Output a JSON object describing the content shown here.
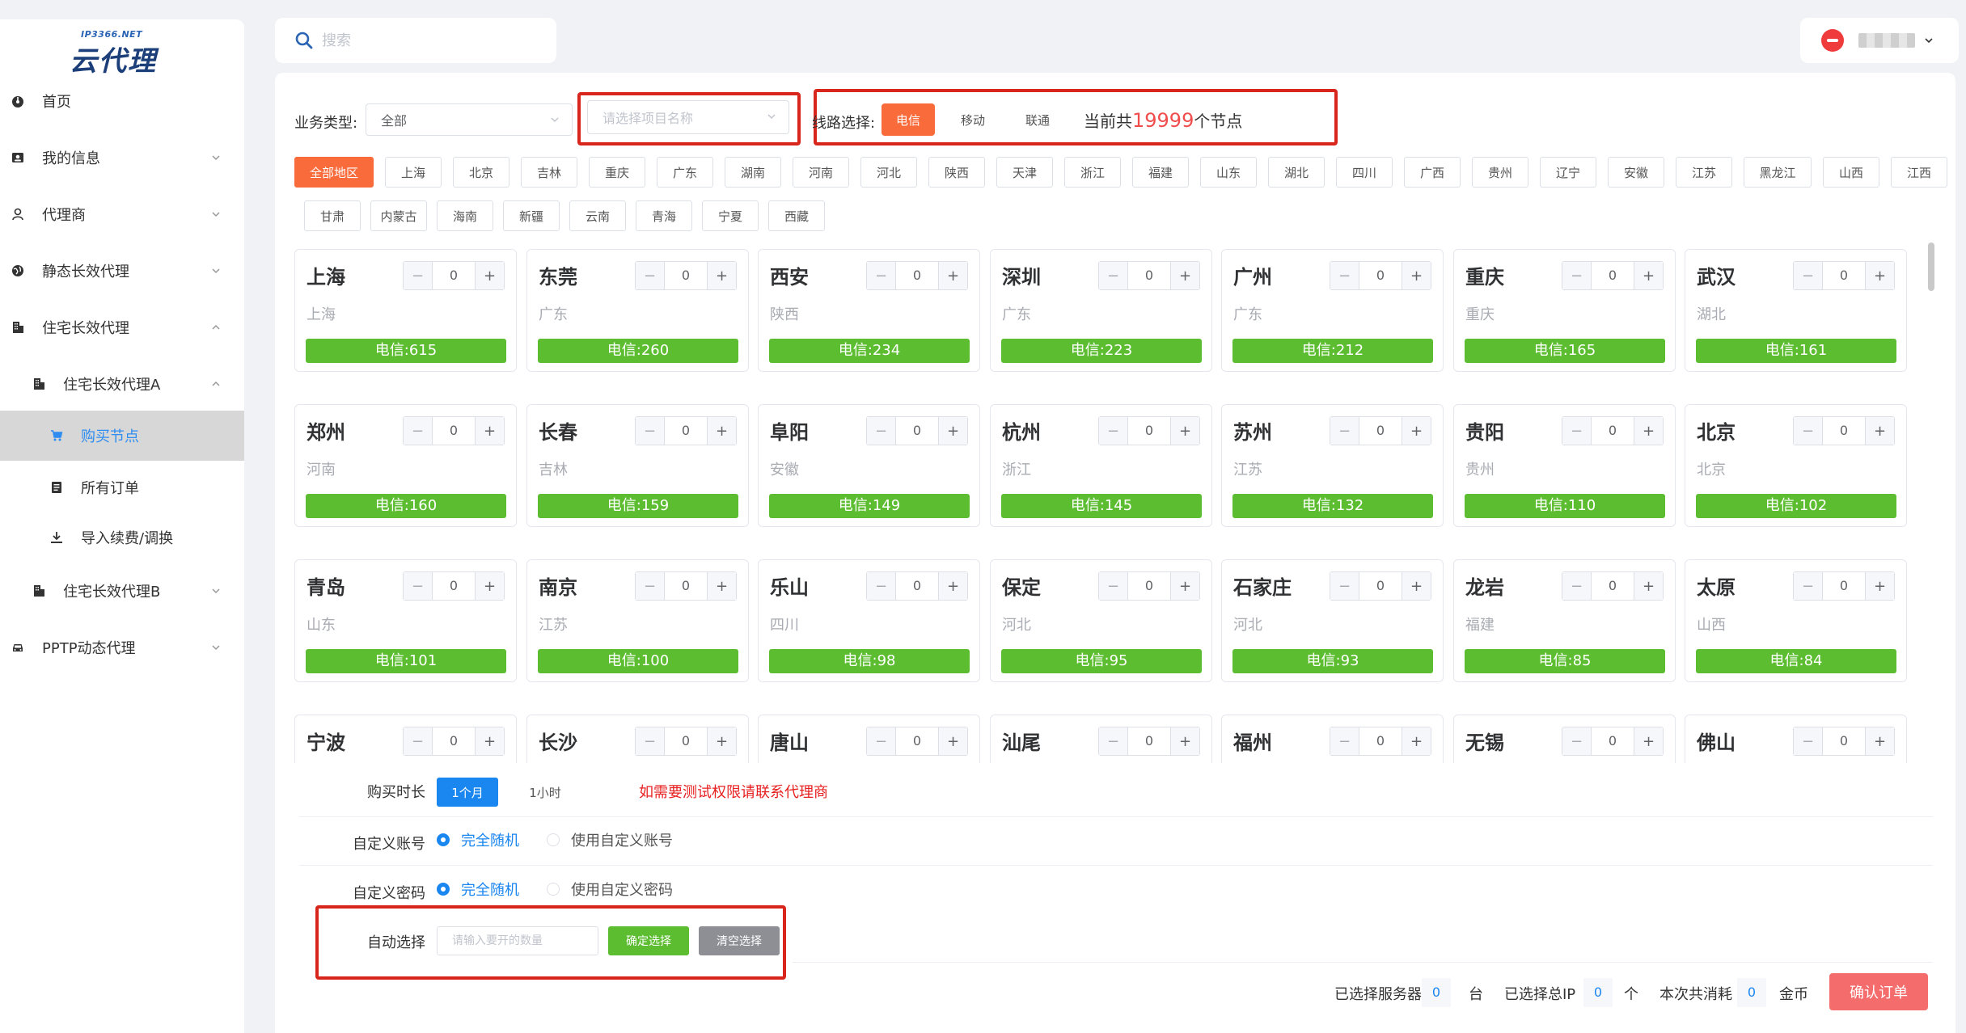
{
  "app": {
    "logo_sub": "IP3366.NET",
    "logo_main": "云代理"
  },
  "search": {
    "placeholder": "搜索"
  },
  "sidebar": {
    "items": [
      {
        "label": "首页",
        "icon": "dashboard-icon"
      },
      {
        "label": "我的信息",
        "icon": "id-card-icon"
      },
      {
        "label": "代理商",
        "icon": "user-icon"
      },
      {
        "label": "静态长效代理",
        "icon": "globe-icon"
      },
      {
        "label": "住宅长效代理",
        "icon": "building-icon"
      },
      {
        "label": "住宅长效代理A",
        "icon": "building-icon"
      },
      {
        "label": "购买节点",
        "icon": "cart-icon"
      },
      {
        "label": "所有订单",
        "icon": "list-icon"
      },
      {
        "label": "导入续费/调换",
        "icon": "import-icon"
      },
      {
        "label": "住宅长效代理B",
        "icon": "building-icon"
      },
      {
        "label": "PPTP动态代理",
        "icon": "car-icon"
      }
    ]
  },
  "filters": {
    "biz_label": "业务类型:",
    "biz_value": "全部",
    "project_placeholder": "请选择项目名称",
    "line_label": "线路选择:",
    "lines": [
      "电信",
      "移动",
      "联通"
    ],
    "count_prefix": "当前共",
    "count_value": "19999",
    "count_suffix": "个节点"
  },
  "regions": [
    "全部地区",
    "上海",
    "北京",
    "吉林",
    "重庆",
    "广东",
    "湖南",
    "河南",
    "河北",
    "陕西",
    "天津",
    "浙江",
    "福建",
    "山东",
    "湖北",
    "四川",
    "广西",
    "贵州",
    "辽宁",
    "安徽",
    "江苏",
    "黑龙江",
    "山西",
    "江西",
    "甘肃",
    "内蒙古",
    "海南",
    "新疆",
    "云南",
    "青海",
    "宁夏",
    "西藏"
  ],
  "nodes": [
    {
      "city": "上海",
      "prov": "上海",
      "qty": "0",
      "line": "电信:615"
    },
    {
      "city": "东莞",
      "prov": "广东",
      "qty": "0",
      "line": "电信:260"
    },
    {
      "city": "西安",
      "prov": "陕西",
      "qty": "0",
      "line": "电信:234"
    },
    {
      "city": "深圳",
      "prov": "广东",
      "qty": "0",
      "line": "电信:223"
    },
    {
      "city": "广州",
      "prov": "广东",
      "qty": "0",
      "line": "电信:212"
    },
    {
      "city": "重庆",
      "prov": "重庆",
      "qty": "0",
      "line": "电信:165"
    },
    {
      "city": "武汉",
      "prov": "湖北",
      "qty": "0",
      "line": "电信:161"
    },
    {
      "city": "郑州",
      "prov": "河南",
      "qty": "0",
      "line": "电信:160"
    },
    {
      "city": "长春",
      "prov": "吉林",
      "qty": "0",
      "line": "电信:159"
    },
    {
      "city": "阜阳",
      "prov": "安徽",
      "qty": "0",
      "line": "电信:149"
    },
    {
      "city": "杭州",
      "prov": "浙江",
      "qty": "0",
      "line": "电信:145"
    },
    {
      "city": "苏州",
      "prov": "江苏",
      "qty": "0",
      "line": "电信:132"
    },
    {
      "city": "贵阳",
      "prov": "贵州",
      "qty": "0",
      "line": "电信:110"
    },
    {
      "city": "北京",
      "prov": "北京",
      "qty": "0",
      "line": "电信:102"
    },
    {
      "city": "青岛",
      "prov": "山东",
      "qty": "0",
      "line": "电信:101"
    },
    {
      "city": "南京",
      "prov": "江苏",
      "qty": "0",
      "line": "电信:100"
    },
    {
      "city": "乐山",
      "prov": "四川",
      "qty": "0",
      "line": "电信:98"
    },
    {
      "city": "保定",
      "prov": "河北",
      "qty": "0",
      "line": "电信:95"
    },
    {
      "city": "石家庄",
      "prov": "河北",
      "qty": "0",
      "line": "电信:93"
    },
    {
      "city": "龙岩",
      "prov": "福建",
      "qty": "0",
      "line": "电信:85"
    },
    {
      "city": "太原",
      "prov": "山西",
      "qty": "0",
      "line": "电信:84"
    },
    {
      "city": "宁波",
      "prov": "",
      "qty": "0",
      "line": ""
    },
    {
      "city": "长沙",
      "prov": "",
      "qty": "0",
      "line": ""
    },
    {
      "city": "唐山",
      "prov": "",
      "qty": "0",
      "line": ""
    },
    {
      "city": "汕尾",
      "prov": "",
      "qty": "0",
      "line": ""
    },
    {
      "city": "福州",
      "prov": "",
      "qty": "0",
      "line": ""
    },
    {
      "city": "无锡",
      "prov": "",
      "qty": "0",
      "line": ""
    },
    {
      "city": "佛山",
      "prov": "",
      "qty": "0",
      "line": ""
    }
  ],
  "form": {
    "duration_label": "购买时长",
    "duration_options": [
      "1个月",
      "1小时"
    ],
    "duration_note": "如需要测试权限请联系代理商",
    "account_label": "自定义账号",
    "account_options": [
      "完全随机",
      "使用自定义账号"
    ],
    "password_label": "自定义密码",
    "password_options": [
      "完全随机",
      "使用自定义密码"
    ],
    "auto_label": "自动选择",
    "auto_placeholder": "请输入要开的数量",
    "confirm_select": "确定选择",
    "clear_select": "清空选择"
  },
  "summary": {
    "servers_label": "已选择服务器",
    "servers_value": "0",
    "servers_unit": "台",
    "ips_label": "已选择总IP",
    "ips_value": "0",
    "ips_unit": "个",
    "cost_label": "本次共消耗",
    "cost_value": "0",
    "cost_unit": "金币",
    "confirm_order": "确认订单"
  },
  "colors": {
    "accent": "#f96b3b",
    "primary": "#1a86f0",
    "success": "#5cbd30",
    "danger": "#f56c6c",
    "highlight_box": "#d9261c"
  }
}
